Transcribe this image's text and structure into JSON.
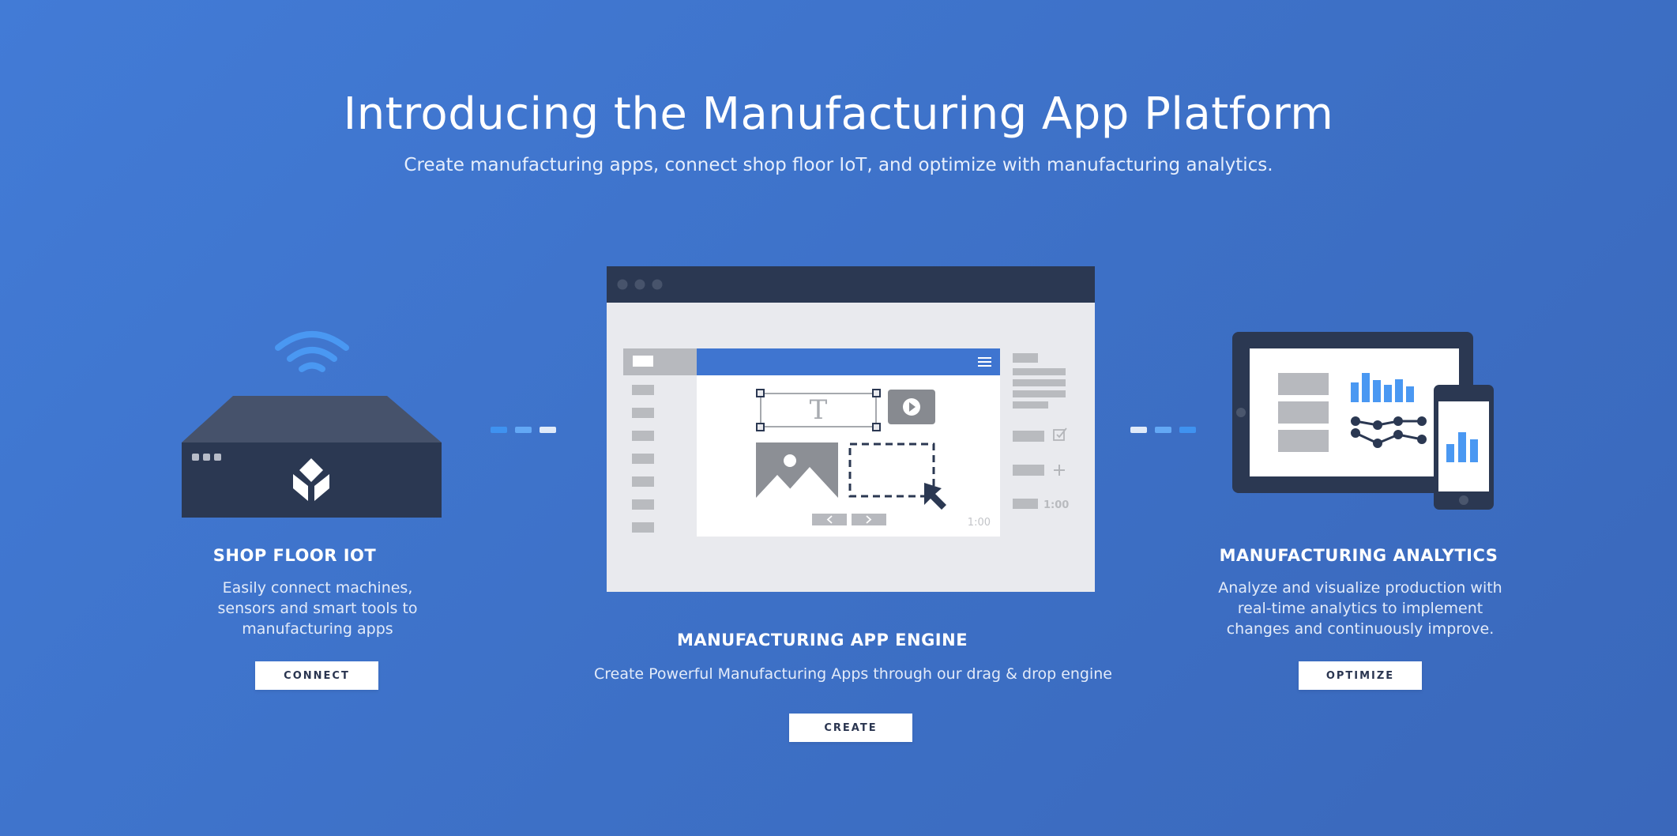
{
  "hero": {
    "title": "Introducing the Manufacturing App Platform",
    "subtitle": "Create manufacturing apps, connect shop floor IoT, and optimize with manufacturing analytics."
  },
  "columns": {
    "iot": {
      "title": "SHOP FLOOR IOT",
      "description_lines": [
        "Easily connect machines,",
        "sensors and smart tools to",
        "manufacturing apps"
      ],
      "button": "CONNECT"
    },
    "engine": {
      "title": "MANUFACTURING APP ENGINE",
      "description": "Create Powerful Manufacturing Apps through our drag & drop engine",
      "button": "CREATE"
    },
    "analytics": {
      "title": "MANUFACTURING ANALYTICS",
      "description_lines": [
        "Analyze and visualize production with",
        "real-time analytics to implement",
        "changes and continuously improve."
      ],
      "button": "OPTIMIZE"
    }
  },
  "illustration": {
    "timer_label": "1:00",
    "sidebar_timer_label": "1:00",
    "text_tool_glyph": "T"
  },
  "colors": {
    "background": "#3f74cc",
    "dark_navy": "#2b3852",
    "accent_blue": "#4a98f2",
    "panel_gray": "#e9eaee",
    "placeholder_gray": "#b7b9be"
  },
  "icons": [
    "wifi-icon",
    "tulip-logo-icon",
    "play-icon",
    "image-icon",
    "cursor-arrow-icon",
    "checkbox-icon",
    "plus-icon",
    "chevron-left-icon",
    "chevron-right-icon",
    "hamburger-menu-icon"
  ]
}
